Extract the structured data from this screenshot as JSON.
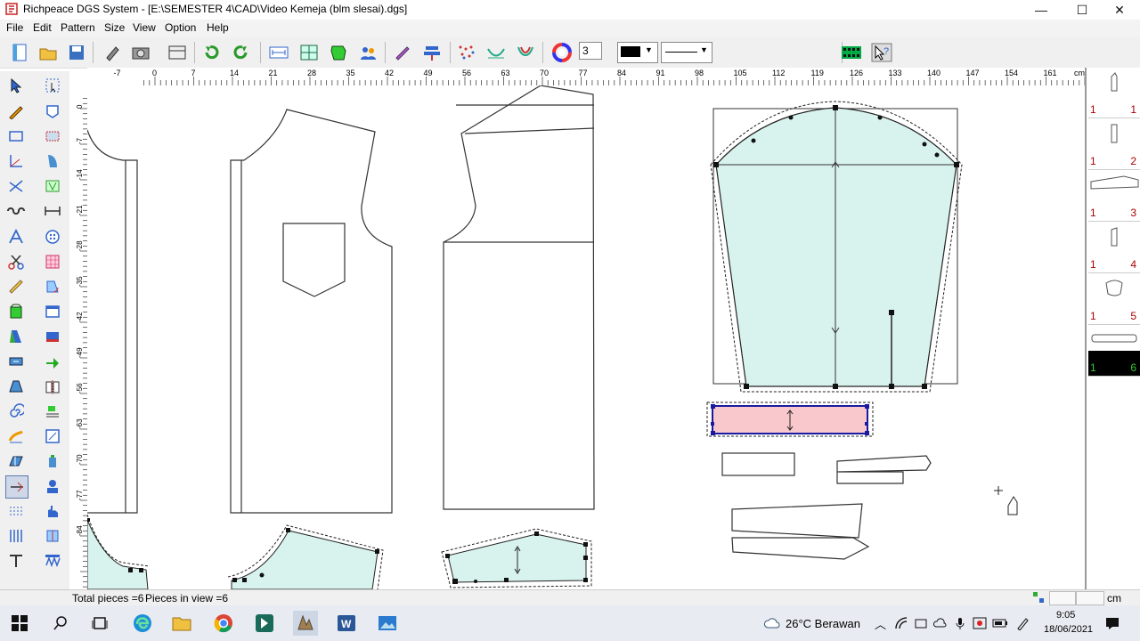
{
  "window": {
    "title": "Richpeace DGS System - [E:\\SEMESTER 4\\CAD\\Video Kemeja (blm slesai).dgs]",
    "minimize": "—",
    "maximize": "☐",
    "close": "✕"
  },
  "menu": [
    "File",
    "Edit",
    "Pattern",
    "Size",
    "View",
    "Option",
    "Help"
  ],
  "toolbar": {
    "line_width_value": "3",
    "color_value": "#000000"
  },
  "ruler": {
    "h_ticks": [
      "-7",
      "0",
      "7",
      "14",
      "21",
      "28",
      "35",
      "42",
      "49",
      "56",
      "63",
      "70",
      "77",
      "84",
      "91",
      "98",
      "105",
      "112",
      "119",
      "126",
      "133",
      "140",
      "147",
      "154",
      "161"
    ],
    "unit": "cm",
    "v_ticks": [
      "0",
      "-7",
      "-14",
      "-21",
      "-28",
      "-35",
      "-42",
      "-49",
      "-56",
      "-63",
      "-70",
      "-77",
      "-84"
    ]
  },
  "pieces_panel": [
    {
      "size": "1",
      "num": "1"
    },
    {
      "size": "1",
      "num": "2"
    },
    {
      "size": "1",
      "num": "3"
    },
    {
      "size": "1",
      "num": "4"
    },
    {
      "size": "1",
      "num": "5"
    },
    {
      "size": "1",
      "num": "6"
    }
  ],
  "status": {
    "total_pieces": "Total pieces =6",
    "pieces_in_view": "Pieces in view =6",
    "unit": "cm"
  },
  "taskbar": {
    "weather": "26°C  Berawan",
    "time": "9:05",
    "date": "18/06/2021"
  },
  "colors": {
    "piece_fill": "#d8f3ee",
    "selected_fill": "#f8c8cc",
    "selected_border": "#1a1aa0"
  }
}
